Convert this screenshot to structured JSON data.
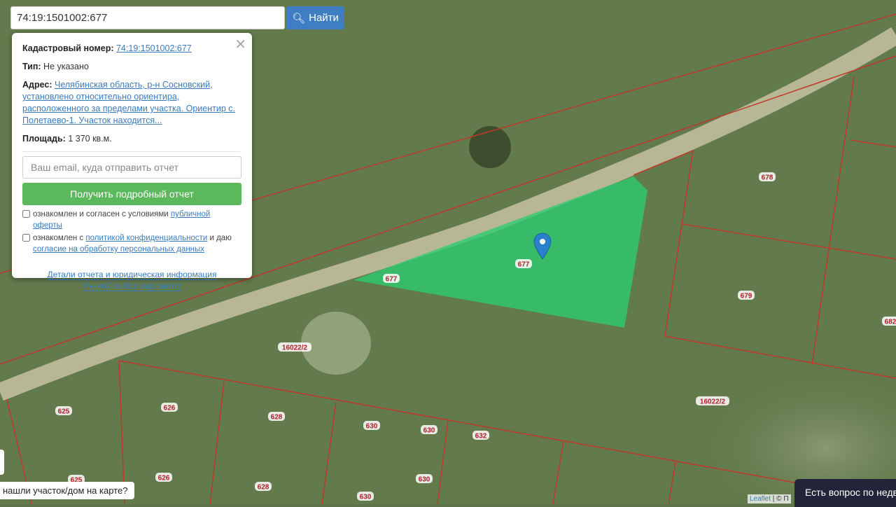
{
  "search": {
    "value": "74:19:1501002:677",
    "button": "Найти",
    "icon": "search-icon"
  },
  "popup": {
    "cad_label": "Кадастровый номер:",
    "cad_value": "74:19:1501002:677",
    "type_label": "Тип:",
    "type_value": "Не указано",
    "addr_label": "Адрес:",
    "addr_value": "Челябинская область, р-н Сосновский, установлено относительно ориентира, расположенного за пределами участка. Ориентир с. Полетаево-1. Участок находится...",
    "area_label": "Площадь:",
    "area_value": "1 370 кв.м.",
    "email_placeholder": "Ваш email, куда отправить отчет",
    "get_button": "Получить подробный отчет",
    "chk1_text": "ознакомлен и согласен с условиями ",
    "chk1_link": "публичной оферты",
    "chk2_text": "ознакомлен с ",
    "chk2_link": "политикой конфиденциальности",
    "chk2_mid": " и даю ",
    "chk2_link2": "согласие на обработку персональных данных",
    "details_link": "Детали отчета и юридическая информация",
    "manual_link": "Ручной выбор вариантов"
  },
  "map": {
    "parcel_labels": [
      "677",
      "677",
      "678",
      "679",
      "16022/2",
      "16022/2",
      "625",
      "626",
      "628",
      "630",
      "630",
      "632",
      "625",
      "626",
      "628",
      "630",
      "630",
      "682"
    ],
    "highlight_color": "#2ecc71",
    "boundary_color": "#c0392b"
  },
  "hint": "нашли участок/дом на карте?",
  "attribution": {
    "leaflet": "Leaflet",
    "sep": " | © П"
  },
  "chat": "Есть вопрос по недвижимости?"
}
